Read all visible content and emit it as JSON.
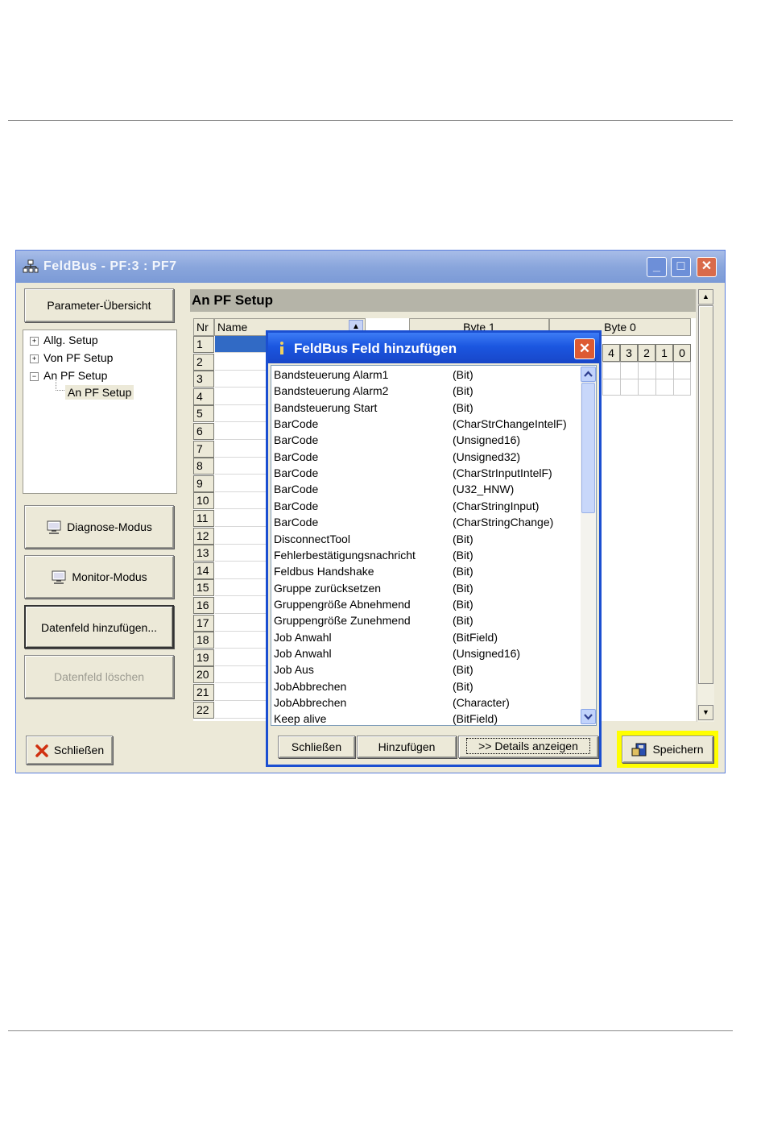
{
  "window": {
    "title": "FeldBus - PF:3 : PF7",
    "minimize": "_",
    "maximize": "□",
    "close": "✕"
  },
  "left": {
    "overview_button": "Parameter-Übersicht",
    "tree": [
      {
        "label": "Allg. Setup",
        "toggle": "+"
      },
      {
        "label": "Von PF Setup",
        "toggle": "+"
      },
      {
        "label": "An PF Setup",
        "toggle": "−"
      },
      {
        "label": "An PF Setup",
        "toggle": ""
      }
    ],
    "diagnose_button": "Diagnose-Modus",
    "monitor_button": "Monitor-Modus",
    "add_field_button": "Datenfeld hinzufügen...",
    "delete_field_button": "Datenfeld löschen",
    "close_button": "Schließen"
  },
  "main": {
    "section_title": "An PF Setup",
    "col_nr": "Nr",
    "col_name": "Name",
    "byte1": "Byte 1",
    "byte0": "Byte 0",
    "bits": [
      "4",
      "3",
      "2",
      "1",
      "0"
    ],
    "rows": [
      "1",
      "2",
      "3",
      "4",
      "5",
      "6",
      "7",
      "8",
      "9",
      "10",
      "11",
      "12",
      "13",
      "14",
      "15",
      "16",
      "17",
      "18",
      "19",
      "20",
      "21",
      "22"
    ],
    "save_button": "Speichern"
  },
  "dialog": {
    "title": "FeldBus Feld hinzufügen",
    "close": "✕",
    "items": [
      {
        "name": "Bandsteuerung Alarm1",
        "type": "(Bit)"
      },
      {
        "name": "Bandsteuerung Alarm2",
        "type": "(Bit)"
      },
      {
        "name": "Bandsteuerung Start",
        "type": "(Bit)"
      },
      {
        "name": "BarCode",
        "type": "(CharStrChangeIntelF)"
      },
      {
        "name": "BarCode",
        "type": "(Unsigned16)"
      },
      {
        "name": "BarCode",
        "type": "(Unsigned32)"
      },
      {
        "name": "BarCode",
        "type": "(CharStrInputIntelF)"
      },
      {
        "name": "BarCode",
        "type": "(U32_HNW)"
      },
      {
        "name": "BarCode",
        "type": "(CharStringInput)"
      },
      {
        "name": "BarCode",
        "type": "(CharStringChange)"
      },
      {
        "name": "DisconnectTool",
        "type": "(Bit)"
      },
      {
        "name": "Fehlerbestätigungsnachricht",
        "type": "(Bit)"
      },
      {
        "name": "Feldbus Handshake",
        "type": "(Bit)"
      },
      {
        "name": "Gruppe zurücksetzen",
        "type": "(Bit)"
      },
      {
        "name": "Gruppengröße Abnehmend",
        "type": "(Bit)"
      },
      {
        "name": "Gruppengröße Zunehmend",
        "type": "(Bit)"
      },
      {
        "name": "Job Anwahl",
        "type": "(BitField)"
      },
      {
        "name": "Job Anwahl",
        "type": "(Unsigned16)"
      },
      {
        "name": "Job Aus",
        "type": "(Bit)"
      },
      {
        "name": "JobAbbrechen",
        "type": "(Bit)"
      },
      {
        "name": "JobAbbrechen",
        "type": "(Character)"
      },
      {
        "name": "Keep alive",
        "type": "(BitField)"
      }
    ],
    "close_button": "Schließen",
    "add_button": "Hinzufügen",
    "details_button": ">> Details anzeigen"
  },
  "colors": {
    "highlight_yellow": "#ffff00",
    "dialog_border": "#1b4fd1",
    "close_red": "#d03010"
  }
}
